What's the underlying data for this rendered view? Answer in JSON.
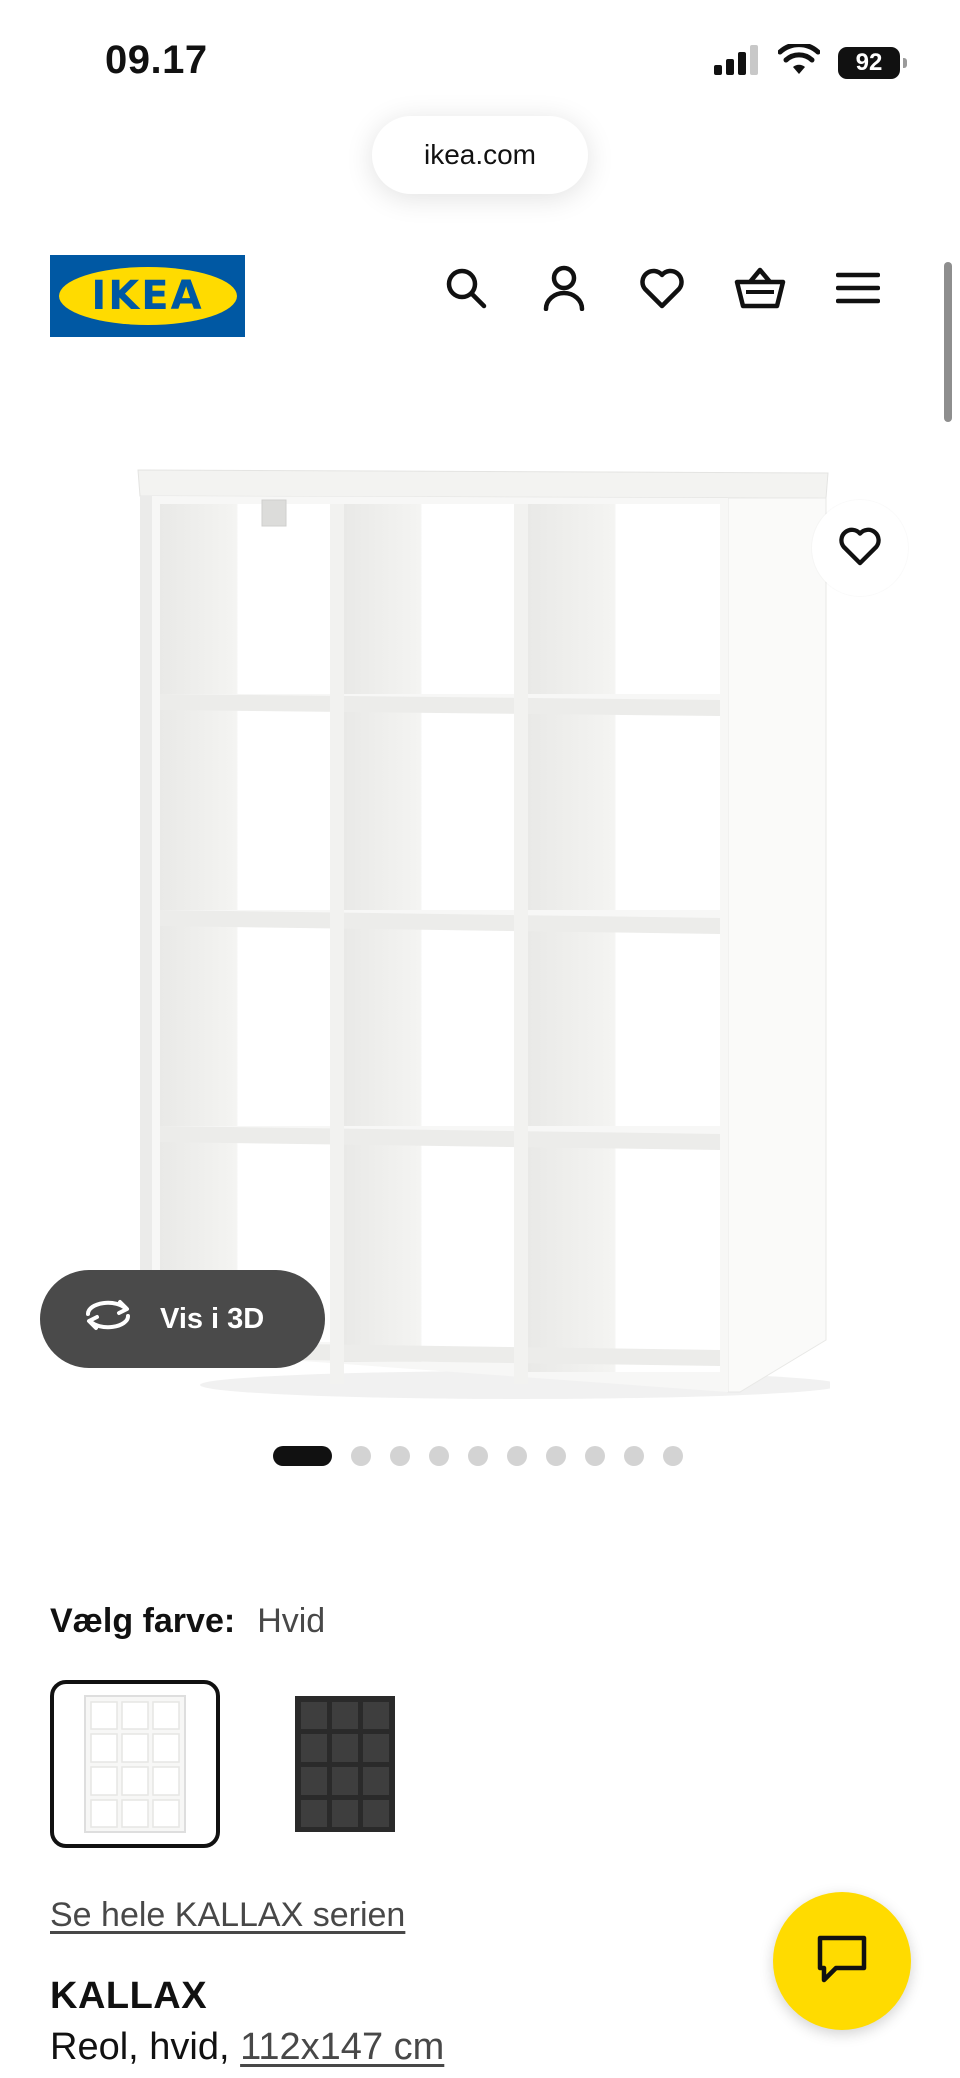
{
  "status_bar": {
    "time": "09.17",
    "battery": "92",
    "icons": [
      "signal-icon",
      "wifi-icon",
      "battery-icon"
    ]
  },
  "browser": {
    "url": "ikea.com"
  },
  "header": {
    "logo_text": "IKEA",
    "icons": [
      "search-icon",
      "account-icon",
      "heart-icon",
      "basket-icon",
      "menu-icon"
    ]
  },
  "gallery": {
    "view_3d_label": "Vis i 3D",
    "image_count": 10,
    "active_index": 0
  },
  "color_selector": {
    "label": "Vælg farve:",
    "selected_value": "Hvid",
    "options": [
      {
        "name": "Hvid",
        "color": "#ffffff",
        "selected": true
      },
      {
        "name": "Sort",
        "color": "#2b2b2b",
        "selected": false
      }
    ]
  },
  "product": {
    "series_link": "Se hele KALLAX serien",
    "name": "KALLAX",
    "description_prefix": "Reol, hvid, ",
    "dimensions": "112x147 cm"
  },
  "colors": {
    "ikea_blue": "#0058a3",
    "ikea_yellow": "#ffdb00",
    "vis3d_bg": "#4a4a4a"
  }
}
